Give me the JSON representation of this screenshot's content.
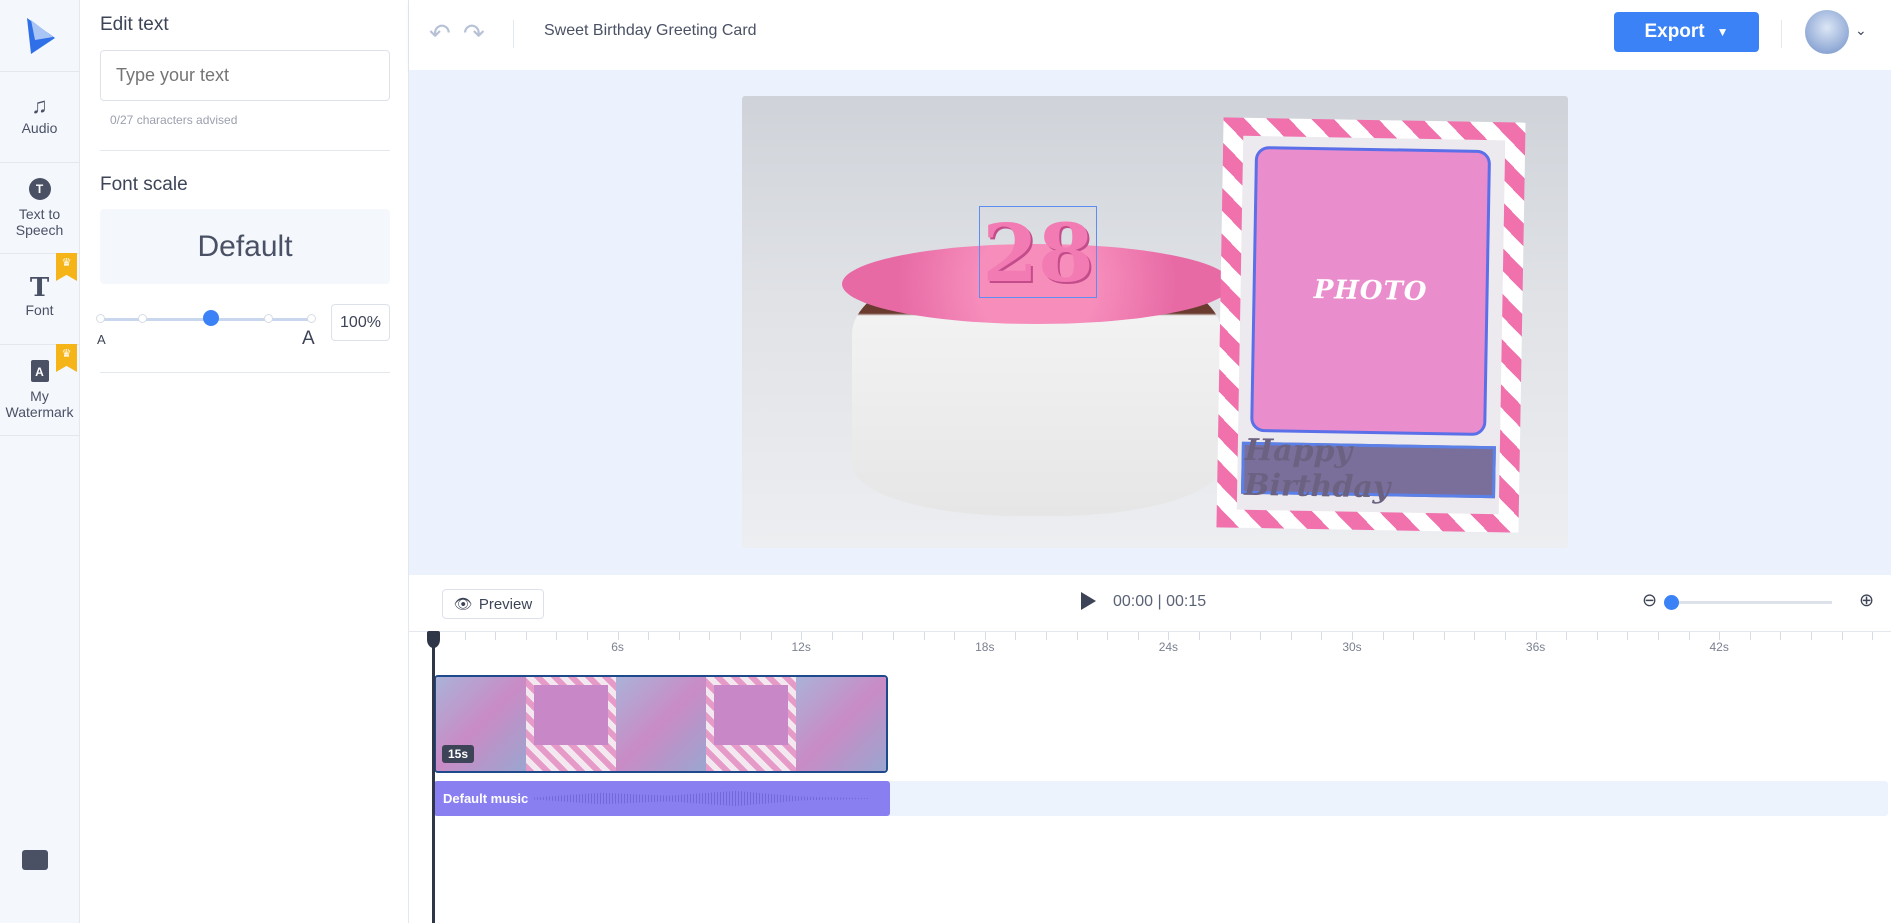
{
  "rail": {
    "items": [
      {
        "label": "Audio",
        "icon": "music-note-icon",
        "premium": false
      },
      {
        "label": "Text to Speech",
        "icon": "speech-bubble-icon",
        "premium": false
      },
      {
        "label": "Font",
        "icon": "font-icon",
        "premium": true
      },
      {
        "label": "My Watermark",
        "icon": "watermark-icon",
        "premium": true
      }
    ]
  },
  "panel": {
    "edit_heading": "Edit text",
    "text_placeholder": "Type your text",
    "char_hint": "0/27  characters advised",
    "scale_heading": "Font scale",
    "scale_preview": "Default",
    "scale_small": "A",
    "scale_large": "A",
    "scale_percent": "100%",
    "scale_value": 100
  },
  "topbar": {
    "title": "Sweet Birthday Greeting Card",
    "export_label": "Export"
  },
  "canvas": {
    "number": "28",
    "photo_label": "PHOTO",
    "caption": "Happy Birthday"
  },
  "controls": {
    "preview_label": "Preview",
    "time": "00:00 | 00:15",
    "zoom_level": 0
  },
  "ruler": {
    "labels": [
      "6s",
      "12s",
      "18s",
      "24s",
      "30s",
      "36s",
      "42s"
    ]
  },
  "timeline": {
    "clip_duration": "15s",
    "audio_label": "Default music"
  },
  "colors": {
    "accent": "#3b82f6",
    "audio": "#8a7ff0",
    "premium": "#f5b418"
  }
}
